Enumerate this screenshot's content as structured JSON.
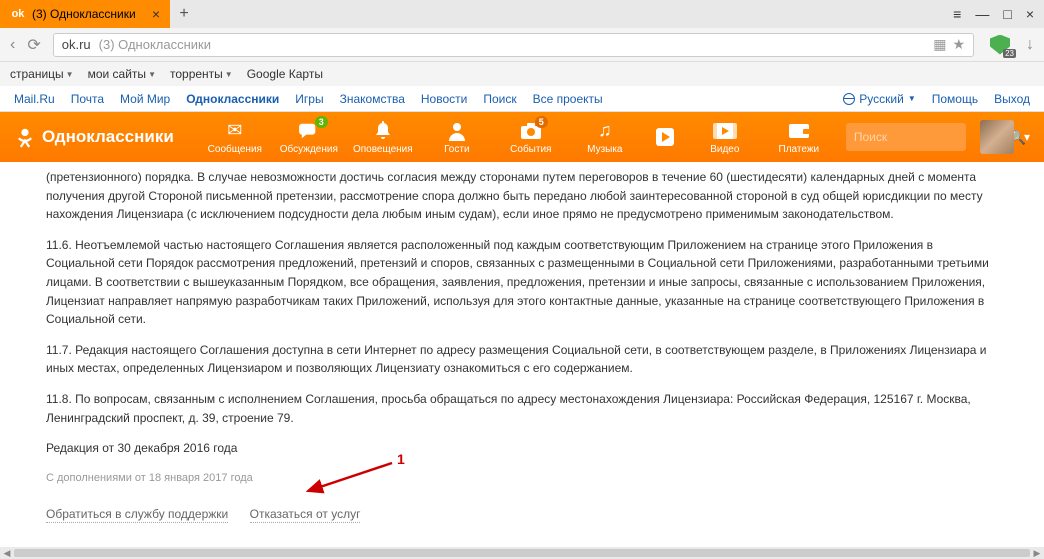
{
  "browser": {
    "tab": {
      "title": "(3) Одноклассники",
      "favicon": "ok"
    },
    "url": "ok.ru",
    "url_title": "(3) Одноклассники",
    "ext_badge": "23"
  },
  "bookmarks": [
    {
      "label": "страницы"
    },
    {
      "label": "мои сайты"
    },
    {
      "label": "торренты"
    },
    {
      "label": "Google Карты"
    }
  ],
  "mailru": {
    "items": [
      "Mail.Ru",
      "Почта",
      "Мой Мир",
      "Одноклассники",
      "Игры",
      "Знакомства",
      "Новости",
      "Поиск",
      "Все проекты"
    ],
    "active_index": 3,
    "lang": "Русский",
    "help": "Помощь",
    "exit": "Выход"
  },
  "ok": {
    "logo": "Одноклассники",
    "nav": [
      {
        "label": "Сообщения",
        "icon": "envelope"
      },
      {
        "label": "Обсуждения",
        "icon": "chat",
        "badge_green": "3"
      },
      {
        "label": "Оповещения",
        "icon": "bell"
      },
      {
        "label": "Гости",
        "icon": "user"
      },
      {
        "label": "События",
        "icon": "camera",
        "badge_dark": "5"
      },
      {
        "label": "Музыка",
        "icon": "note"
      },
      {
        "label": "",
        "icon": "play"
      },
      {
        "label": "Видео",
        "icon": "video"
      },
      {
        "label": "Платежи",
        "icon": "wallet"
      }
    ],
    "search_placeholder": "Поиск"
  },
  "content": {
    "p1": "(претензионного) порядка. В случае невозможности достичь согласия между сторонами путем переговоров в течение 60 (шестидесяти) календарных дней с момента получения другой Стороной письменной претензии, рассмотрение спора должно быть передано любой заинтересованной стороной в суд общей юрисдикции по месту нахождения Лицензиара (с исключением подсудности дела любым иным судам), если иное прямо не предусмотрено применимым законодательством.",
    "p2": "11.6. Неотъемлемой частью настоящего Соглашения является расположенный под каждым соответствующим Приложением на странице этого Приложения в Социальной сети Порядок рассмотрения предложений, претензий и споров, связанных с размещенными в Социальной сети Приложениями, разработанными третьими лицами. В соответствии с вышеуказанным Порядком, все обращения, заявления, предложения, претензии и иные запросы, связанные с использованием Приложения, Лицензиат направляет напрямую разработчикам таких Приложений, используя для этого контактные данные, указанные на странице соответствующего Приложения в Социальной сети.",
    "p3": "11.7. Редакция настоящего Соглашения доступна в сети Интернет по адресу размещения Социальной сети, в соответствующем разделе, в Приложениях Лицензиара и иных местах, определенных Лицензиаром и позволяющих Лицензиату ознакомиться с его содержанием.",
    "p4": "11.8. По вопросам, связанным с исполнением Соглашения, просьба обращаться по адресу местонахождения Лицензиара: Российская Федерация, 125167 г. Москва, Ленинградский проспект, д. 39, строение 79.",
    "revision": "Редакция от 30 декабря 2016 года",
    "addendum": "С дополнениями от 18 января 2017 года",
    "link_support": "Обратиться в службу поддержки",
    "link_optout": "Отказаться от услуг"
  },
  "annotation": {
    "label": "1"
  }
}
